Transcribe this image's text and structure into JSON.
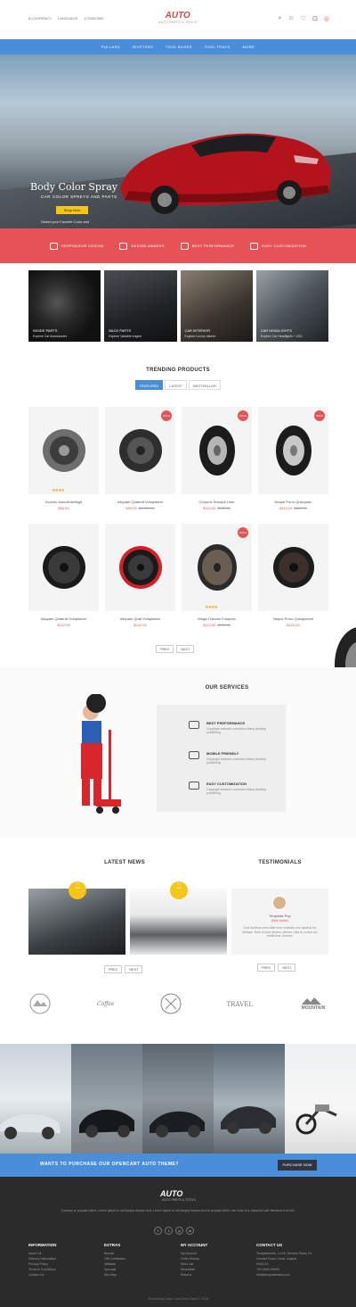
{
  "topbar": {
    "currency": "$ CURRENCY",
    "language": "LANGUAGE",
    "phone": "1234567890",
    "icons": [
      "search-icon",
      "user-icon",
      "heart-icon",
      "bag-icon",
      "cart-icon"
    ]
  },
  "logo": {
    "brand": "AUTO",
    "tagline": "AUTO PARTS & TOOLS"
  },
  "nav": [
    "PULLARS",
    "RIVETERS",
    "TOOL BOXES",
    "TOOL TRAYS",
    "MORE"
  ],
  "hero": {
    "title": "Body Color Spray",
    "subtitle": "CAR COLOR SPREYS AND PARTS",
    "button": "Shop Now",
    "note": "Select your Favorite Color and"
  },
  "features": [
    "RESPONSIVE DESIGN",
    "DESIGN AWARDS",
    "BEST PERFORMANCE",
    "EASY CUSTOMIZATION"
  ],
  "categories": [
    {
      "label": "INSIDE PARTS",
      "sub": "Explore Car Accessories"
    },
    {
      "label": "BACK PARTS",
      "sub": "Explore Variable engine"
    },
    {
      "label": "CAR INTERIOR",
      "sub": "Explore Luxury interior"
    },
    {
      "label": "CAR HEADLIGHTS",
      "sub": "Explore Car Headlights + LED"
    }
  ],
  "trending": {
    "title": "TRENDING PRODUCTS",
    "tabs": [
      "FEATURED",
      "LATEST",
      "BESTSELLER"
    ]
  },
  "products": [
    {
      "name": "Accedu Autodit Aeflagit",
      "price": "$54.99",
      "old": "",
      "sale": false,
      "stars": "★★★★"
    },
    {
      "name": "Aliquam Quaerat Voluptatem",
      "price": "$90.00",
      "old": "$1,000.00",
      "sale": true,
      "stars": ""
    },
    {
      "name": "Corporis Suscipit Libor",
      "price": "$114.00",
      "old": "$122.00",
      "sale": true,
      "stars": ""
    },
    {
      "name": "Neque Porro Quisquam",
      "price": "$114.00",
      "old": "$122.00",
      "sale": true,
      "stars": ""
    },
    {
      "name": "Aliquam Quaerat Voluptatem",
      "price": "$122.00",
      "old": "",
      "sale": false,
      "stars": ""
    },
    {
      "name": "Aliquam Quat Voluptatem",
      "price": "$242.00",
      "old": "",
      "sale": false,
      "stars": ""
    },
    {
      "name": "Magni Dolores Eosques",
      "price": "$113.60",
      "old": "$122.00",
      "sale": true,
      "stars": "★★★★"
    },
    {
      "name": "Neque Porro Quisquamet",
      "price": "$122.00",
      "old": "",
      "sale": false,
      "stars": ""
    }
  ],
  "pager": {
    "prev": "PREV",
    "next": "NEXT"
  },
  "services": {
    "title": "OUR SERVICES",
    "items": [
      {
        "title": "BEST PREFORMANCE",
        "desc": "Copyright network correction Many desktop publishing"
      },
      {
        "title": "MOBILE FRIENDLY",
        "desc": "Copyright network correction Many desktop publishing"
      },
      {
        "title": "EASY CUSTOMIZATION",
        "desc": "Copyright network correction Many desktop publishing"
      }
    ]
  },
  "news": {
    "title": "LATEST NEWS",
    "items": [
      {
        "date": "10",
        "mon": "JAN"
      },
      {
        "date": "10",
        "mon": "JAN"
      }
    ]
  },
  "testimonials": {
    "title": "TESTIMONIALS",
    "name": "Tenjunda Pop",
    "role": "(Web Adder)",
    "quote": "Duis faucibus enim vitae nunc molestie, nec dapibus leo tristique. Nam ut dolor laoreet, ultrices nulla ut, cursus dui vestibulum. Aenean."
  },
  "brands": [
    "",
    "Coffee",
    "",
    "TRAVEL",
    "MOUNTAIN"
  ],
  "cta": {
    "text": "WANTS TO PURCHASE OUR OPENCART AUTO THEME?",
    "button": "PURCHASE NOW"
  },
  "footer": {
    "brand": "AUTO",
    "tagline": "AUTO PARTS & TOOLS",
    "desc": "Contrary to popular belief, Lorem Ipsum is not simply random text. Lorem Ipsum is not simply random text to popular belief, the roots of a classical Latin literature from 45.",
    "social": [
      "f",
      "t",
      "g",
      "in"
    ],
    "cols": [
      {
        "title": "INFORMATION",
        "links": [
          "About Us",
          "Delivery Information",
          "Privacy Policy",
          "Terms & Conditions",
          "Contact Us"
        ]
      },
      {
        "title": "EXTRAS",
        "links": [
          "Brands",
          "Gift Certificates",
          "Affiliates",
          "Specials",
          "Site Map"
        ]
      },
      {
        "title": "MY ACCOUNT",
        "links": [
          "My Account",
          "Order History",
          "Wish List",
          "Newsletter",
          "Returns"
        ]
      },
      {
        "title": "CONTACT US",
        "links": [
          "Templatemela, 4-125, Nirvana Plaza, Dr.",
          "Gurukul Road, Surat, Gujarat",
          "994/1/10",
          "+91-9999-99999",
          "info@templatemela.com"
        ]
      }
    ],
    "copyright": "Powered By Open Cart Demo Store © 2016"
  }
}
